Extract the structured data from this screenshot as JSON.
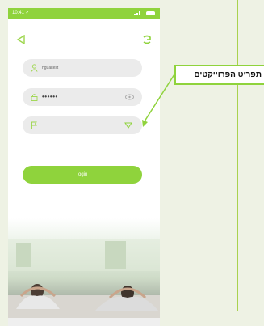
{
  "status_bar": {
    "time": "10:41 ✓"
  },
  "form": {
    "username_value": "hgualtest",
    "password_value": "••••••",
    "project_value": "",
    "login_label": "login"
  },
  "callout": {
    "text": "תפריט הפרוייקטים"
  },
  "colors": {
    "accent": "#8fd33c",
    "field": "#ebebeb",
    "line": "#a9d24e"
  },
  "icons": [
    "back-icon",
    "settings-icon",
    "user-icon",
    "lock-icon",
    "eye-icon",
    "flag-icon",
    "dropdown-icon"
  ]
}
